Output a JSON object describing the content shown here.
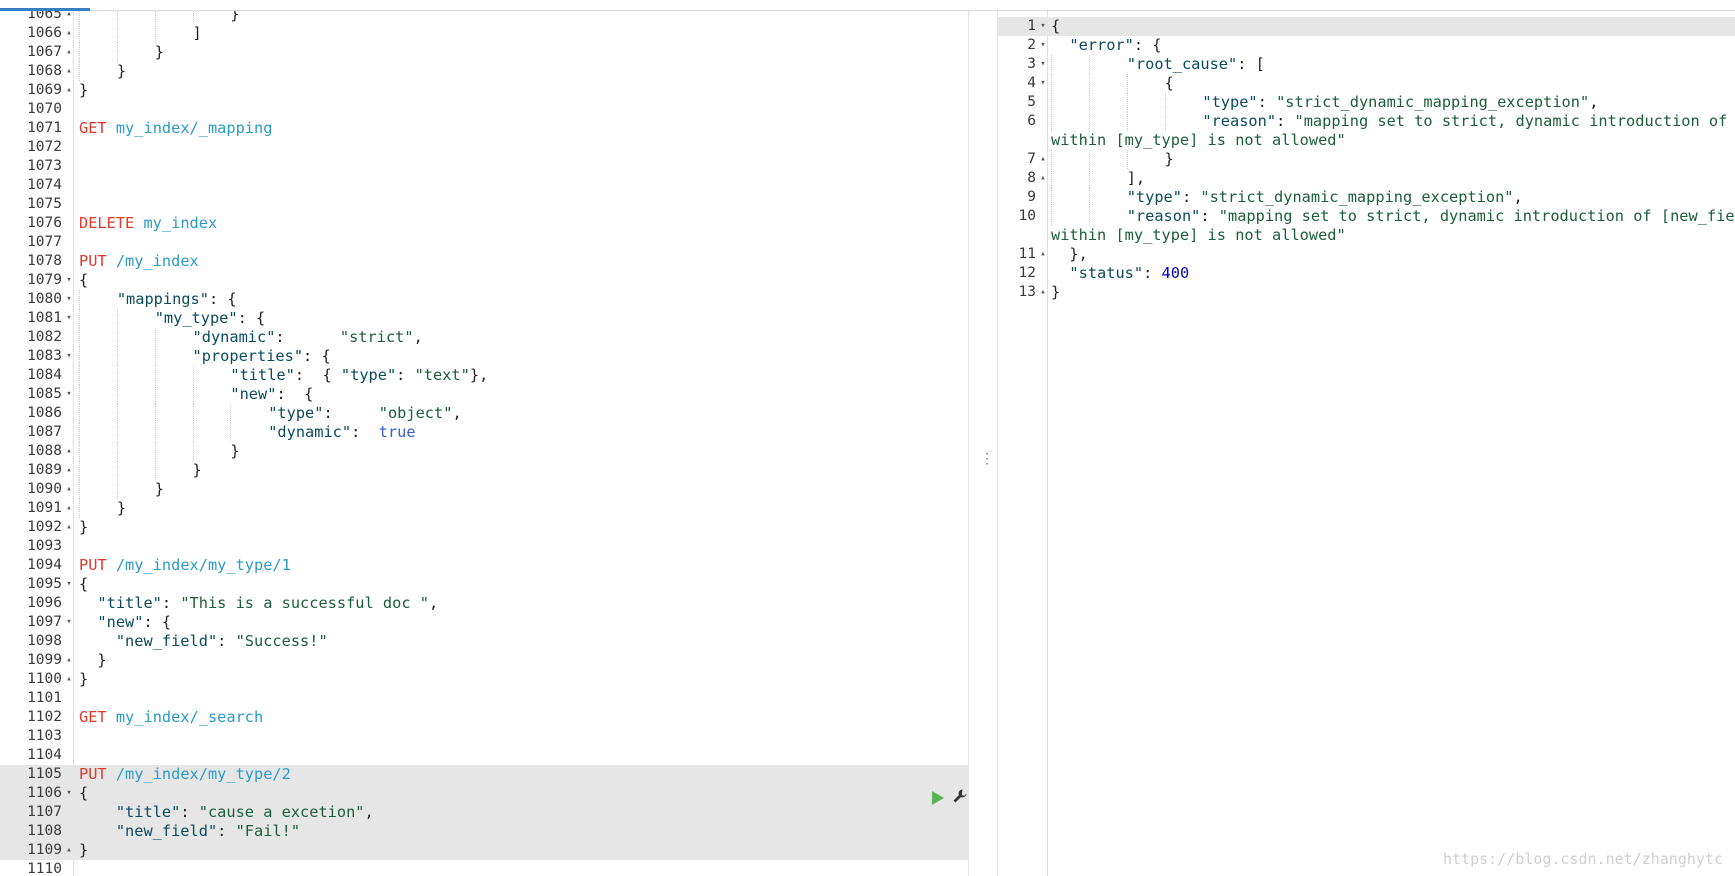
{
  "left_editor": {
    "lines": [
      {
        "n": "1065",
        "fold": "▴",
        "tokens": [
          {
            "c": "t-punc",
            "t": "}"
          }
        ],
        "indent": 4
      },
      {
        "n": "1066",
        "fold": "▴",
        "tokens": [
          {
            "c": "t-punc",
            "t": "]"
          }
        ],
        "indent": 3
      },
      {
        "n": "1067",
        "fold": "▴",
        "tokens": [
          {
            "c": "t-punc",
            "t": "}"
          }
        ],
        "indent": 2
      },
      {
        "n": "1068",
        "fold": "▴",
        "tokens": [
          {
            "c": "t-punc",
            "t": "}"
          }
        ],
        "indent": 1
      },
      {
        "n": "1069",
        "fold": "▴",
        "tokens": [
          {
            "c": "t-punc",
            "t": "}"
          }
        ],
        "indent": 0
      },
      {
        "n": "1070",
        "fold": "",
        "tokens": [],
        "indent": 0
      },
      {
        "n": "1071",
        "fold": "",
        "tokens": [
          {
            "c": "t-method",
            "t": "GET"
          },
          {
            "c": "t-url",
            "t": " my_index/_mapping"
          }
        ],
        "indent": 0
      },
      {
        "n": "1072",
        "fold": "",
        "tokens": [],
        "indent": 0
      },
      {
        "n": "1073",
        "fold": "",
        "tokens": [],
        "indent": 0
      },
      {
        "n": "1074",
        "fold": "",
        "tokens": [],
        "indent": 0
      },
      {
        "n": "1075",
        "fold": "",
        "tokens": [],
        "indent": 0
      },
      {
        "n": "1076",
        "fold": "",
        "tokens": [
          {
            "c": "t-method",
            "t": "DELETE"
          },
          {
            "c": "t-url",
            "t": " my_index"
          }
        ],
        "indent": 0
      },
      {
        "n": "1077",
        "fold": "",
        "tokens": [],
        "indent": 0
      },
      {
        "n": "1078",
        "fold": "",
        "tokens": [
          {
            "c": "t-method",
            "t": "PUT"
          },
          {
            "c": "t-url",
            "t": " /my_index"
          }
        ],
        "indent": 0
      },
      {
        "n": "1079",
        "fold": "▾",
        "tokens": [
          {
            "c": "t-punc",
            "t": "{"
          }
        ],
        "indent": 0
      },
      {
        "n": "1080",
        "fold": "▾",
        "tokens": [
          {
            "c": "t-key",
            "t": "\"mappings\""
          },
          {
            "c": "t-punc",
            "t": ": {"
          }
        ],
        "indent": 1
      },
      {
        "n": "1081",
        "fold": "▾",
        "tokens": [
          {
            "c": "t-key",
            "t": "\"my_type\""
          },
          {
            "c": "t-punc",
            "t": ": {"
          }
        ],
        "indent": 2
      },
      {
        "n": "1082",
        "fold": "",
        "tokens": [
          {
            "c": "t-key",
            "t": "\"dynamic\""
          },
          {
            "c": "t-punc",
            "t": ":      "
          },
          {
            "c": "t-str",
            "t": "\"strict\""
          },
          {
            "c": "t-punc",
            "t": ","
          }
        ],
        "indent": 3
      },
      {
        "n": "1083",
        "fold": "▾",
        "tokens": [
          {
            "c": "t-key",
            "t": "\"properties\""
          },
          {
            "c": "t-punc",
            "t": ": {"
          }
        ],
        "indent": 3
      },
      {
        "n": "1084",
        "fold": "",
        "tokens": [
          {
            "c": "t-key",
            "t": "\"title\""
          },
          {
            "c": "t-punc",
            "t": ":  { "
          },
          {
            "c": "t-key",
            "t": "\"type\""
          },
          {
            "c": "t-punc",
            "t": ": "
          },
          {
            "c": "t-str",
            "t": "\"text\""
          },
          {
            "c": "t-punc",
            "t": "},"
          }
        ],
        "indent": 4
      },
      {
        "n": "1085",
        "fold": "▾",
        "tokens": [
          {
            "c": "t-key",
            "t": "\"new\""
          },
          {
            "c": "t-punc",
            "t": ":  {"
          }
        ],
        "indent": 4
      },
      {
        "n": "1086",
        "fold": "",
        "tokens": [
          {
            "c": "t-key",
            "t": "\"type\""
          },
          {
            "c": "t-punc",
            "t": ":     "
          },
          {
            "c": "t-str",
            "t": "\"object\""
          },
          {
            "c": "t-punc",
            "t": ","
          }
        ],
        "indent": 5
      },
      {
        "n": "1087",
        "fold": "",
        "tokens": [
          {
            "c": "t-key",
            "t": "\"dynamic\""
          },
          {
            "c": "t-punc",
            "t": ":  "
          },
          {
            "c": "t-bool",
            "t": "true"
          }
        ],
        "indent": 5
      },
      {
        "n": "1088",
        "fold": "▴",
        "tokens": [
          {
            "c": "t-punc",
            "t": "}"
          }
        ],
        "indent": 4
      },
      {
        "n": "1089",
        "fold": "▴",
        "tokens": [
          {
            "c": "t-punc",
            "t": "}"
          }
        ],
        "indent": 3
      },
      {
        "n": "1090",
        "fold": "▴",
        "tokens": [
          {
            "c": "t-punc",
            "t": "}"
          }
        ],
        "indent": 2
      },
      {
        "n": "1091",
        "fold": "▴",
        "tokens": [
          {
            "c": "t-punc",
            "t": "}"
          }
        ],
        "indent": 1
      },
      {
        "n": "1092",
        "fold": "▴",
        "tokens": [
          {
            "c": "t-punc",
            "t": "}"
          }
        ],
        "indent": 0
      },
      {
        "n": "1093",
        "fold": "",
        "tokens": [],
        "indent": 0
      },
      {
        "n": "1094",
        "fold": "",
        "tokens": [
          {
            "c": "t-method",
            "t": "PUT"
          },
          {
            "c": "t-url",
            "t": " /my_index/my_type/1"
          }
        ],
        "indent": 0
      },
      {
        "n": "1095",
        "fold": "▾",
        "tokens": [
          {
            "c": "t-punc",
            "t": "{"
          }
        ],
        "indent": 0
      },
      {
        "n": "1096",
        "fold": "",
        "tokens": [
          {
            "c": "t-punc",
            "t": "  "
          },
          {
            "c": "t-key",
            "t": "\"title\""
          },
          {
            "c": "t-punc",
            "t": ": "
          },
          {
            "c": "t-str",
            "t": "\"This is a successful doc \""
          },
          {
            "c": "t-punc",
            "t": ","
          }
        ],
        "indent": 0
      },
      {
        "n": "1097",
        "fold": "▾",
        "tokens": [
          {
            "c": "t-punc",
            "t": "  "
          },
          {
            "c": "t-key",
            "t": "\"new\""
          },
          {
            "c": "t-punc",
            "t": ": {"
          }
        ],
        "indent": 0
      },
      {
        "n": "1098",
        "fold": "",
        "tokens": [
          {
            "c": "t-punc",
            "t": "    "
          },
          {
            "c": "t-key",
            "t": "\"new_field\""
          },
          {
            "c": "t-punc",
            "t": ": "
          },
          {
            "c": "t-str",
            "t": "\"Success!\""
          }
        ],
        "indent": 0
      },
      {
        "n": "1099",
        "fold": "▴",
        "tokens": [
          {
            "c": "t-punc",
            "t": "  }"
          }
        ],
        "indent": 0
      },
      {
        "n": "1100",
        "fold": "▴",
        "tokens": [
          {
            "c": "t-punc",
            "t": "}"
          }
        ],
        "indent": 0
      },
      {
        "n": "1101",
        "fold": "",
        "tokens": [],
        "indent": 0
      },
      {
        "n": "1102",
        "fold": "",
        "tokens": [
          {
            "c": "t-method",
            "t": "GET"
          },
          {
            "c": "t-url",
            "t": " my_index/_search"
          }
        ],
        "indent": 0
      },
      {
        "n": "1103",
        "fold": "",
        "tokens": [],
        "indent": 0
      },
      {
        "n": "1104",
        "fold": "",
        "tokens": [],
        "indent": 0
      },
      {
        "n": "1105",
        "fold": "",
        "tokens": [
          {
            "c": "t-method",
            "t": "PUT"
          },
          {
            "c": "t-url",
            "t": " /my_index/my_type/2"
          }
        ],
        "indent": 0,
        "hl": true
      },
      {
        "n": "1106",
        "fold": "▾",
        "tokens": [
          {
            "c": "t-punc",
            "t": "{"
          }
        ],
        "indent": 0,
        "hl": true
      },
      {
        "n": "1107",
        "fold": "",
        "tokens": [
          {
            "c": "t-punc",
            "t": "    "
          },
          {
            "c": "t-key",
            "t": "\"title\""
          },
          {
            "c": "t-punc",
            "t": ": "
          },
          {
            "c": "t-str",
            "t": "\"cause a excetion\""
          },
          {
            "c": "t-punc",
            "t": ","
          }
        ],
        "indent": 0,
        "hl": true
      },
      {
        "n": "1108",
        "fold": "",
        "tokens": [
          {
            "c": "t-punc",
            "t": "    "
          },
          {
            "c": "t-key",
            "t": "\"new_field\""
          },
          {
            "c": "t-punc",
            "t": ": "
          },
          {
            "c": "t-str",
            "t": "\"Fail!\""
          }
        ],
        "indent": 0,
        "hl": true
      },
      {
        "n": "1109",
        "fold": "▴",
        "tokens": [
          {
            "c": "t-punc",
            "t": "}"
          }
        ],
        "indent": 0,
        "hl": true
      },
      {
        "n": "1110",
        "fold": "",
        "tokens": [],
        "indent": 0
      }
    ]
  },
  "right_editor": {
    "lines": [
      {
        "n": "1",
        "fold": "▾",
        "tokens": [
          {
            "c": "t-punc",
            "t": "{"
          }
        ],
        "indent": 0,
        "hl": true
      },
      {
        "n": "2",
        "fold": "▾",
        "tokens": [
          {
            "c": "t-punc",
            "t": "  "
          },
          {
            "c": "t-key",
            "t": "\"error\""
          },
          {
            "c": "t-punc",
            "t": ": {"
          }
        ],
        "indent": 0
      },
      {
        "n": "3",
        "fold": "▾",
        "tokens": [
          {
            "c": "t-key",
            "t": "\"root_cause\""
          },
          {
            "c": "t-punc",
            "t": ": ["
          }
        ],
        "indent": 2
      },
      {
        "n": "4",
        "fold": "▾",
        "tokens": [
          {
            "c": "t-punc",
            "t": "{"
          }
        ],
        "indent": 3
      },
      {
        "n": "5",
        "fold": "",
        "tokens": [
          {
            "c": "t-key",
            "t": "\"type\""
          },
          {
            "c": "t-punc",
            "t": ": "
          },
          {
            "c": "t-str",
            "t": "\"strict_dynamic_mapping_exception\""
          },
          {
            "c": "t-punc",
            "t": ","
          }
        ],
        "indent": 4
      },
      {
        "n": "6",
        "fold": "",
        "tokens": [
          {
            "c": "t-key",
            "t": "\"reason\""
          },
          {
            "c": "t-punc",
            "t": ": "
          },
          {
            "c": "t-str",
            "t": "\"mapping set to strict, dynamic introduction of [new_field]"
          }
        ],
        "indent": 4
      },
      {
        "n": "",
        "fold": "",
        "tokens": [
          {
            "c": "t-str",
            "t": "within [my_type] is not allowed\""
          }
        ],
        "indent": 0
      },
      {
        "n": "7",
        "fold": "▴",
        "tokens": [
          {
            "c": "t-punc",
            "t": "}"
          }
        ],
        "indent": 3
      },
      {
        "n": "8",
        "fold": "▴",
        "tokens": [
          {
            "c": "t-punc",
            "t": "],"
          }
        ],
        "indent": 2
      },
      {
        "n": "9",
        "fold": "",
        "tokens": [
          {
            "c": "t-key",
            "t": "\"type\""
          },
          {
            "c": "t-punc",
            "t": ": "
          },
          {
            "c": "t-str",
            "t": "\"strict_dynamic_mapping_exception\""
          },
          {
            "c": "t-punc",
            "t": ","
          }
        ],
        "indent": 2
      },
      {
        "n": "10",
        "fold": "",
        "tokens": [
          {
            "c": "t-key",
            "t": "\"reason\""
          },
          {
            "c": "t-punc",
            "t": ": "
          },
          {
            "c": "t-str",
            "t": "\"mapping set to strict, dynamic introduction of [new_field]"
          }
        ],
        "indent": 2
      },
      {
        "n": "",
        "fold": "",
        "tokens": [
          {
            "c": "t-str",
            "t": "within [my_type] is not allowed\""
          }
        ],
        "indent": 0
      },
      {
        "n": "11",
        "fold": "▴",
        "tokens": [
          {
            "c": "t-punc",
            "t": "  },"
          }
        ],
        "indent": 0
      },
      {
        "n": "12",
        "fold": "",
        "tokens": [
          {
            "c": "t-punc",
            "t": "  "
          },
          {
            "c": "t-key",
            "t": "\"status\""
          },
          {
            "c": "t-punc",
            "t": ": "
          },
          {
            "c": "t-num",
            "t": "400"
          }
        ],
        "indent": 0
      },
      {
        "n": "13",
        "fold": "▴",
        "tokens": [
          {
            "c": "t-punc",
            "t": "}"
          }
        ],
        "indent": 0
      }
    ]
  },
  "actions": {
    "play_icon": "play-icon",
    "wrench_icon": "wrench-icon"
  },
  "divider_handle": "⋮",
  "watermark": "https://blog.csdn.net/zhanghytc",
  "colors": {
    "method": "#e0392b",
    "url": "#2a9bc6",
    "key": "#0b4a5c",
    "string": "#1c5d3c",
    "boolean": "#3b5bdb",
    "number": "#0000cc",
    "play": "#5ab552"
  }
}
